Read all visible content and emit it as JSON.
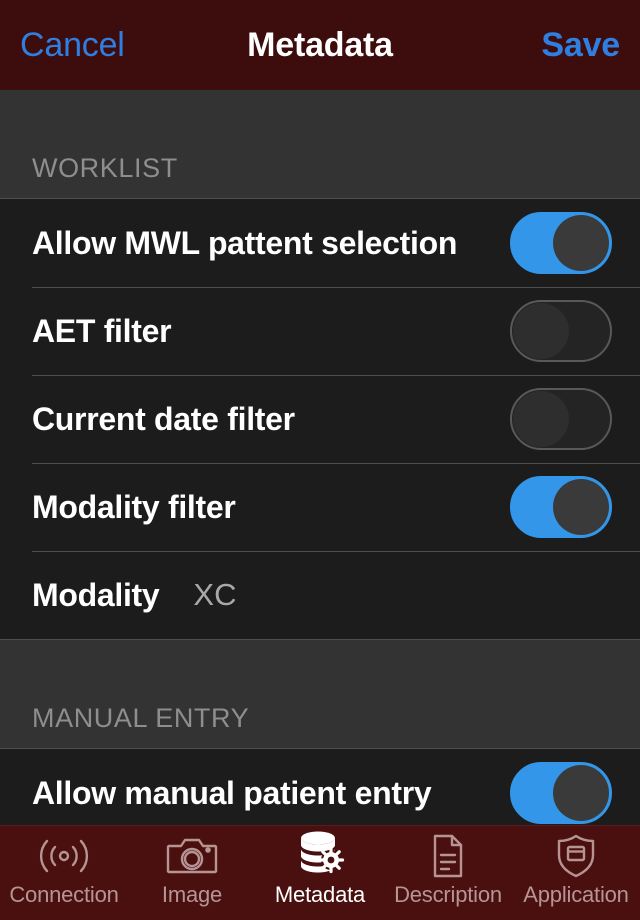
{
  "navbar": {
    "cancel_label": "Cancel",
    "title": "Metadata",
    "save_label": "Save",
    "background_color": "#3d0c0c",
    "accent_color": "#2f7fe0"
  },
  "sections": [
    {
      "header": "WORKLIST",
      "rows": [
        {
          "label": "Allow MWL pattent selection",
          "control": "toggle",
          "value": "on"
        },
        {
          "label": "AET filter",
          "control": "toggle",
          "value": "off"
        },
        {
          "label": "Current date filter",
          "control": "toggle",
          "value": "off"
        },
        {
          "label": "Modality filter",
          "control": "toggle",
          "value": "on"
        },
        {
          "label": "Modality",
          "control": "text",
          "value": "XC"
        }
      ]
    },
    {
      "header": "MANUAL ENTRY",
      "rows": [
        {
          "label": "Allow manual patient entry",
          "control": "toggle",
          "value": "on"
        }
      ]
    }
  ],
  "colors": {
    "toggle_on": "#3396e8",
    "toggle_off_border": "#595959",
    "row_background": "#1c1c1c",
    "section_background": "#333333",
    "tabbar_background": "#4a1010",
    "section_header_text": "#8e8e8e",
    "row_value_text": "#a8a8a8"
  },
  "tabbar": {
    "tabs": [
      {
        "label": "Connection",
        "icon": "broadcast-signal-icon",
        "active": false
      },
      {
        "label": "Image",
        "icon": "camera-icon",
        "active": false
      },
      {
        "label": "Metadata",
        "icon": "database-gear-icon",
        "active": true
      },
      {
        "label": "Description",
        "icon": "document-lines-icon",
        "active": false
      },
      {
        "label": "Application",
        "icon": "shield-window-icon",
        "active": false
      }
    ]
  }
}
